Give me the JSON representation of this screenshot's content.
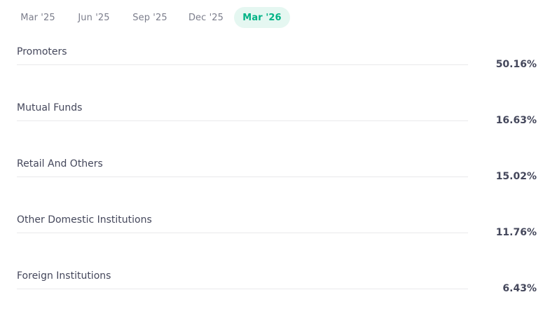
{
  "tabs": [
    {
      "label": "Mar '25",
      "active": false
    },
    {
      "label": "Jun '25",
      "active": false
    },
    {
      "label": "Sep '25",
      "active": false
    },
    {
      "label": "Dec '25",
      "active": false
    },
    {
      "label": "Mar '26",
      "active": true
    }
  ],
  "holdings": [
    {
      "label": "Promoters",
      "value": "50.16%"
    },
    {
      "label": "Mutual Funds",
      "value": "16.63%"
    },
    {
      "label": "Retail And Others",
      "value": "15.02%"
    },
    {
      "label": "Other Domestic Institutions",
      "value": "11.76%"
    },
    {
      "label": "Foreign Institutions",
      "value": "6.43%"
    }
  ],
  "colors": {
    "accent": "#00b386",
    "accent_bg": "#e5f7f1",
    "text": "#44475b",
    "muted": "#7c7e8c",
    "divider": "#e9e9eb"
  }
}
